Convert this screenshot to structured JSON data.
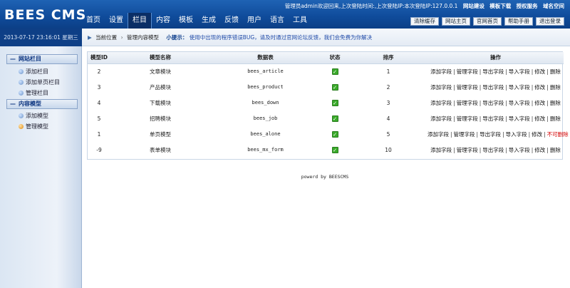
{
  "header": {
    "logo": "BEES CMS",
    "welcome": "管理员admin欢迎回来,上次登陆时间:,上次登陆IP:本次登陆IP:127.0.0.1",
    "links": [
      "网站建设",
      "模板下载",
      "授权服务",
      "域名空间"
    ],
    "nav": [
      "首页",
      "设置",
      "栏目",
      "内容",
      "模板",
      "生成",
      "反馈",
      "用户",
      "语言",
      "工具"
    ],
    "nav_active_index": 2,
    "buttons": [
      "清除缓存",
      "网站主页",
      "官网首页",
      "帮助手册",
      "退出登录"
    ]
  },
  "timebar": {
    "datetime": "2013-07-17 23:16:01",
    "weekday": "星期三"
  },
  "breadcrumb": {
    "current_label": "当前位置",
    "page": "管理内容模型",
    "tip_label": "小提示：",
    "tip": "使用中出现的程序错误BUG，请及时通过官网论坛反馈，我们会免费为你解决"
  },
  "sidebar": {
    "groups": [
      {
        "title": "网站栏目",
        "items": [
          "添加栏目",
          "添加单页栏目",
          "管理栏目"
        ]
      },
      {
        "title": "内容模型",
        "items": [
          "添加模型",
          "管理模型"
        ]
      }
    ]
  },
  "table": {
    "headers": [
      "模型ID",
      "模型名称",
      "数据表",
      "状态",
      "排序",
      "操作"
    ],
    "rows": [
      {
        "id": "2",
        "name": "文章模块",
        "table": "bees_article",
        "sort": "1",
        "ops": [
          "添加字段",
          "管理字段",
          "导出字段",
          "导入字段",
          "修改",
          "删除"
        ]
      },
      {
        "id": "3",
        "name": "产品模块",
        "table": "bees_product",
        "sort": "2",
        "ops": [
          "添加字段",
          "管理字段",
          "导出字段",
          "导入字段",
          "修改",
          "删除"
        ]
      },
      {
        "id": "4",
        "name": "下载模块",
        "table": "bees_down",
        "sort": "3",
        "ops": [
          "添加字段",
          "管理字段",
          "导出字段",
          "导入字段",
          "修改",
          "删除"
        ]
      },
      {
        "id": "5",
        "name": "招聘模块",
        "table": "bees_job",
        "sort": "4",
        "ops": [
          "添加字段",
          "管理字段",
          "导出字段",
          "导入字段",
          "修改",
          "删除"
        ]
      },
      {
        "id": "1",
        "name": "单页模型",
        "table": "bees_alone",
        "sort": "5",
        "ops": [
          "添加字段",
          "管理字段",
          "导出字段",
          "导入字段",
          "修改",
          "不可删除"
        ]
      },
      {
        "id": "-9",
        "name": "表单模块",
        "table": "bees_mx_form",
        "sort": "10",
        "ops": [
          "添加字段",
          "管理字段",
          "导出字段",
          "导入字段",
          "修改",
          "删除"
        ]
      }
    ],
    "status_icon": "check-icon"
  },
  "footer": {
    "text": "powerd by BEESCMS"
  },
  "colors": {
    "header_blue": "#0f4b9a",
    "accent_dark": "#0a2e66",
    "danger": "#d40000",
    "status_green": "#3aaa2a"
  }
}
